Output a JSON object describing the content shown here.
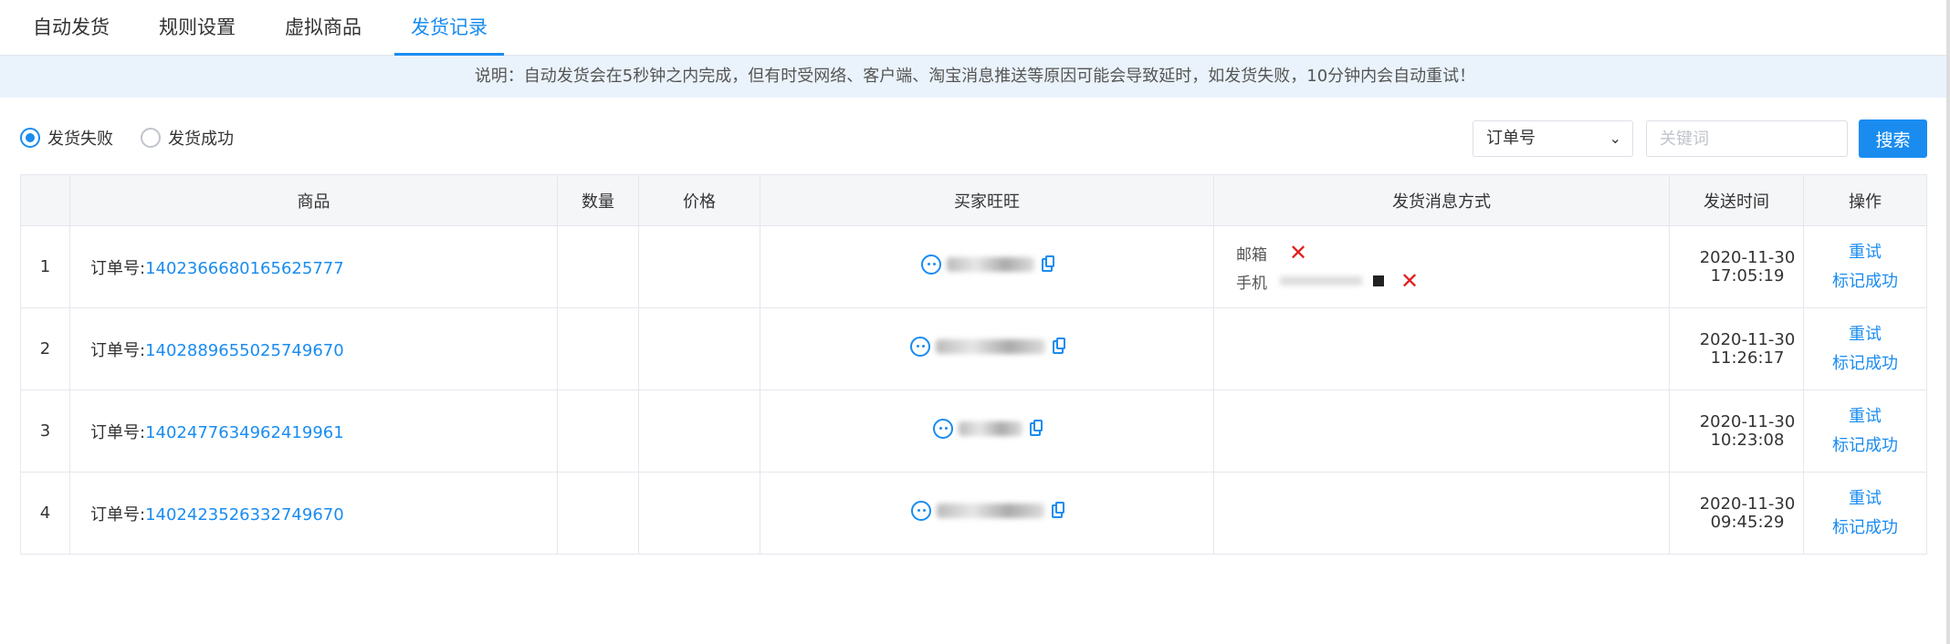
{
  "tabs": [
    {
      "label": "自动发货"
    },
    {
      "label": "规则设置"
    },
    {
      "label": "虚拟商品"
    },
    {
      "label": "发货记录",
      "active": true
    }
  ],
  "notice": "说明：自动发货会在5秒钟之内完成，但有时受网络、客户端、淘宝消息推送等原因可能会导致延时，如发货失败，10分钟内会自动重试！",
  "filter": {
    "fail_label": "发货失败",
    "success_label": "发货成功",
    "selected": "fail"
  },
  "search": {
    "select_value": "订单号",
    "placeholder": "关键词",
    "button_label": "搜索"
  },
  "table": {
    "headers": {
      "index": "",
      "goods": "商品",
      "qty": "数量",
      "price": "价格",
      "buyer": "买家旺旺",
      "method": "发货消息方式",
      "time": "发送时间",
      "action": "操作"
    },
    "order_prefix": "订单号:",
    "rows": [
      {
        "index": "1",
        "order_no": "1402366680165625777",
        "qty": "",
        "price": "",
        "method_email": "邮箱",
        "method_phone": "手机",
        "date": "2020-11-30",
        "clock": "17:05:19",
        "retry": "重试",
        "mark": "标记成功"
      },
      {
        "index": "2",
        "order_no": "1402889655025749670",
        "qty": "",
        "price": "",
        "date": "2020-11-30",
        "clock": "11:26:17",
        "retry": "重试",
        "mark": "标记成功"
      },
      {
        "index": "3",
        "order_no": "1402477634962419961",
        "qty": "",
        "price": "",
        "date": "2020-11-30",
        "clock": "10:23:08",
        "retry": "重试",
        "mark": "标记成功"
      },
      {
        "index": "4",
        "order_no": "1402423526332749670",
        "qty": "",
        "price": "",
        "date": "2020-11-30",
        "clock": "09:45:29",
        "retry": "重试",
        "mark": "标记成功"
      }
    ]
  },
  "colors": {
    "accent": "#1a8cf0",
    "notice_bg": "#eaf3fc",
    "fail": "#e02020"
  }
}
